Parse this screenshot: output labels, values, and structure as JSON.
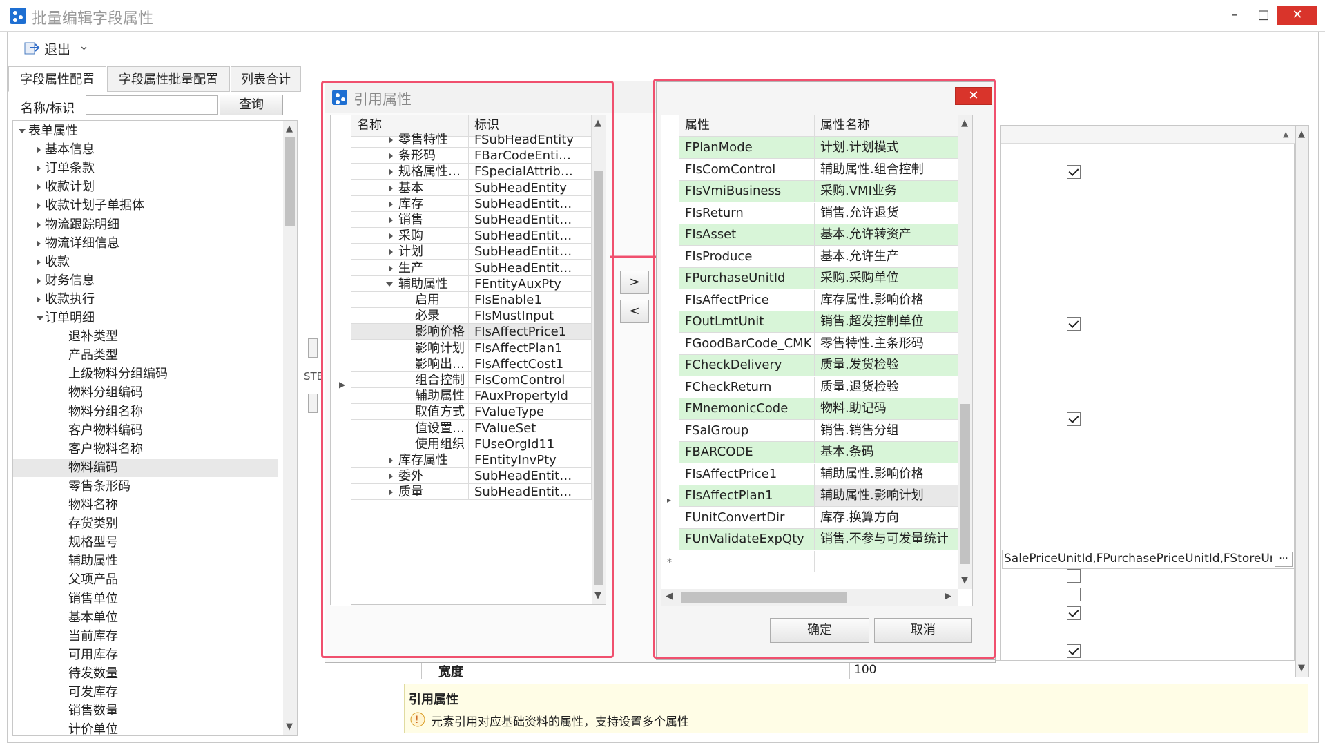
{
  "window": {
    "title": "批量编辑字段属性",
    "min": "–",
    "max": "□",
    "close": "✕"
  },
  "toolbar": {
    "exit_label": "退出",
    "more": "⌄"
  },
  "tabs": [
    {
      "label": "字段属性配置"
    },
    {
      "label": "字段属性批量配置"
    },
    {
      "label": "列表合计"
    }
  ],
  "search": {
    "label": "名称/标识",
    "value": "",
    "button": "查询"
  },
  "tree": {
    "root": "表单属性",
    "groups": [
      "基本信息",
      "订单条款",
      "收款计划",
      "收款计划子单据体",
      "物流跟踪明细",
      "物流详细信息",
      "收款",
      "财务信息",
      "收款执行"
    ],
    "expanded": "订单明细",
    "children": [
      "退补类型",
      "产品类型",
      "上级物料分组编码",
      "物料分组编码",
      "物料分组名称",
      "客户物料编码",
      "客户物料名称",
      "物料编码",
      "零售条形码",
      "物料名称",
      "存货类别",
      "规格型号",
      "辅助属性",
      "父项产品",
      "销售单位",
      "基本单位",
      "当前库存",
      "可用库存",
      "待发数量",
      "可发库存",
      "销售数量",
      "计价单位"
    ],
    "selected": "物料编码"
  },
  "left_dialog": {
    "title": "引用属性",
    "col_name": "名称",
    "col_id": "标识",
    "rows": [
      {
        "n": "零售特性",
        "id": "FSubHeadEntity",
        "lv": 1,
        "exp": "r"
      },
      {
        "n": "条形码",
        "id": "FBarCodeEnti…",
        "lv": 1,
        "exp": "r"
      },
      {
        "n": "规格属性列表",
        "id": "FSpecialAttrib…",
        "lv": 1,
        "exp": "r"
      },
      {
        "n": "基本",
        "id": "SubHeadEntity",
        "lv": 1,
        "exp": "r"
      },
      {
        "n": "库存",
        "id": "SubHeadEntit…",
        "lv": 1,
        "exp": "r"
      },
      {
        "n": "销售",
        "id": "SubHeadEntit…",
        "lv": 1,
        "exp": "r"
      },
      {
        "n": "采购",
        "id": "SubHeadEntit…",
        "lv": 1,
        "exp": "r"
      },
      {
        "n": "计划",
        "id": "SubHeadEntit…",
        "lv": 1,
        "exp": "r"
      },
      {
        "n": "生产",
        "id": "SubHeadEntit…",
        "lv": 1,
        "exp": "r"
      },
      {
        "n": "辅助属性",
        "id": "FEntityAuxPty",
        "lv": 1,
        "exp": "d"
      },
      {
        "n": "启用",
        "id": "FIsEnable1",
        "lv": 2,
        "exp": ""
      },
      {
        "n": "必录",
        "id": "FIsMustInput",
        "lv": 2,
        "exp": ""
      },
      {
        "n": "影响价格",
        "id": "FIsAffectPrice1",
        "lv": 2,
        "exp": "",
        "sel": true
      },
      {
        "n": "影响计划",
        "id": "FIsAffectPlan1",
        "lv": 2,
        "exp": ""
      },
      {
        "n": "影响出库成本",
        "id": "FIsAffectCost1",
        "lv": 2,
        "exp": ""
      },
      {
        "n": "组合控制",
        "id": "FIsComControl",
        "lv": 2,
        "exp": ""
      },
      {
        "n": "辅助属性",
        "id": "FAuxPropertyId",
        "lv": 2,
        "exp": ""
      },
      {
        "n": "取值方式",
        "id": "FValueType",
        "lv": 2,
        "exp": ""
      },
      {
        "n": "值设置状态",
        "id": "FValueSet",
        "lv": 2,
        "exp": ""
      },
      {
        "n": "使用组织",
        "id": "FUseOrgId11",
        "lv": 2,
        "exp": ""
      },
      {
        "n": "库存属性",
        "id": "FEntityInvPty",
        "lv": 1,
        "exp": "r"
      },
      {
        "n": "委外",
        "id": "SubHeadEntit…",
        "lv": 1,
        "exp": "r"
      },
      {
        "n": "质量",
        "id": "SubHeadEntit…",
        "lv": 1,
        "exp": "r"
      }
    ]
  },
  "move": {
    "right": ">",
    "left": "<"
  },
  "right_dialog": {
    "close": "✕",
    "col_attr": "属性",
    "col_name": "属性名称",
    "new_row_marker": "*",
    "current_marker": "▸",
    "rows": [
      {
        "a": "FPlanMode",
        "n": "计划.计划模式",
        "g": true
      },
      {
        "a": "FIsComControl",
        "n": "辅助属性.组合控制",
        "g": false
      },
      {
        "a": "FIsVmiBusiness",
        "n": "采购.VMI业务",
        "g": true
      },
      {
        "a": "FIsReturn",
        "n": "销售.允许退货",
        "g": false
      },
      {
        "a": "FIsAsset",
        "n": "基本.允许转资产",
        "g": true
      },
      {
        "a": "FIsProduce",
        "n": "基本.允许生产",
        "g": false
      },
      {
        "a": "FPurchaseUnitId",
        "n": "采购.采购单位",
        "g": true
      },
      {
        "a": "FIsAffectPrice",
        "n": "库存属性.影响价格",
        "g": false
      },
      {
        "a": "FOutLmtUnit",
        "n": "销售.超发控制单位",
        "g": true
      },
      {
        "a": "FGoodBarCode_CMK",
        "n": "零售特性.主条形码",
        "g": false
      },
      {
        "a": "FCheckDelivery",
        "n": "质量.发货检验",
        "g": true
      },
      {
        "a": "FCheckReturn",
        "n": "质量.退货检验",
        "g": false
      },
      {
        "a": "FMnemonicCode",
        "n": "物料.助记码",
        "g": true
      },
      {
        "a": "FSalGroup",
        "n": "销售.销售分组",
        "g": false
      },
      {
        "a": "FBARCODE",
        "n": "基本.条码",
        "g": true
      },
      {
        "a": "FIsAffectPrice1",
        "n": "辅助属性.影响价格",
        "g": false
      },
      {
        "a": "FIsAffectPlan1",
        "n": "辅助属性.影响计划",
        "g": true,
        "cur": true
      },
      {
        "a": "FUnitConvertDir",
        "n": "库存.换算方向",
        "g": false
      },
      {
        "a": "FUnValidateExpQty",
        "n": "销售.不参与可发量统计",
        "g": true
      }
    ],
    "ok": "确定",
    "cancel": "取消"
  },
  "background": {
    "ste": "STE",
    "long_value": "SalePriceUnitId,FPurchasePriceUnitId,FStoreUni…",
    "ellipsis_btn": "···",
    "width_label": "宽度",
    "width_value": "100",
    "checkboxes": [
      true,
      true,
      true,
      false,
      false,
      true,
      true
    ]
  },
  "help": {
    "title": "引用属性",
    "text": "元素引用对应基础资料的属性，支持设置多个属性"
  }
}
